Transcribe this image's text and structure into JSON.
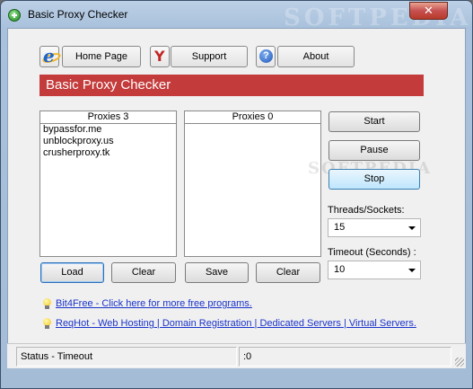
{
  "window": {
    "title": "Basic Proxy Checker",
    "close_glyph": "✕",
    "watermark": "SOFTPEDIA",
    "accent_color": "#c43b3b"
  },
  "toolbar": {
    "home_label": "Home Page",
    "support_label": "Support",
    "about_label": "About",
    "home_icon": "ie-icon",
    "support_icon": "yahoo-icon",
    "about_icon": "help-icon"
  },
  "banner": {
    "title": "Basic Proxy Checker"
  },
  "lists": {
    "left": {
      "header": "Proxies 3",
      "items": [
        "bypassfor.me",
        "unblockproxy.us",
        "crusherproxy.tk"
      ]
    },
    "right": {
      "header": "Proxies 0",
      "items": []
    }
  },
  "list_buttons": {
    "load": "Load",
    "clear_left": "Clear",
    "save": "Save",
    "clear_right": "Clear"
  },
  "controls": {
    "start": "Start",
    "pause": "Pause",
    "stop": "Stop",
    "threads_label": "Threads/Sockets:",
    "threads_value": "15",
    "timeout_label": "Timeout (Seconds) :",
    "timeout_value": "10"
  },
  "links": [
    {
      "text": "Bit4Free - Click here for more free programs."
    },
    {
      "text": "ReqHot - Web Hosting | Domain Registration | Dedicated Servers | Virtual Servers."
    }
  ],
  "status": {
    "left": "Status - Timeout",
    "right": ":0"
  }
}
